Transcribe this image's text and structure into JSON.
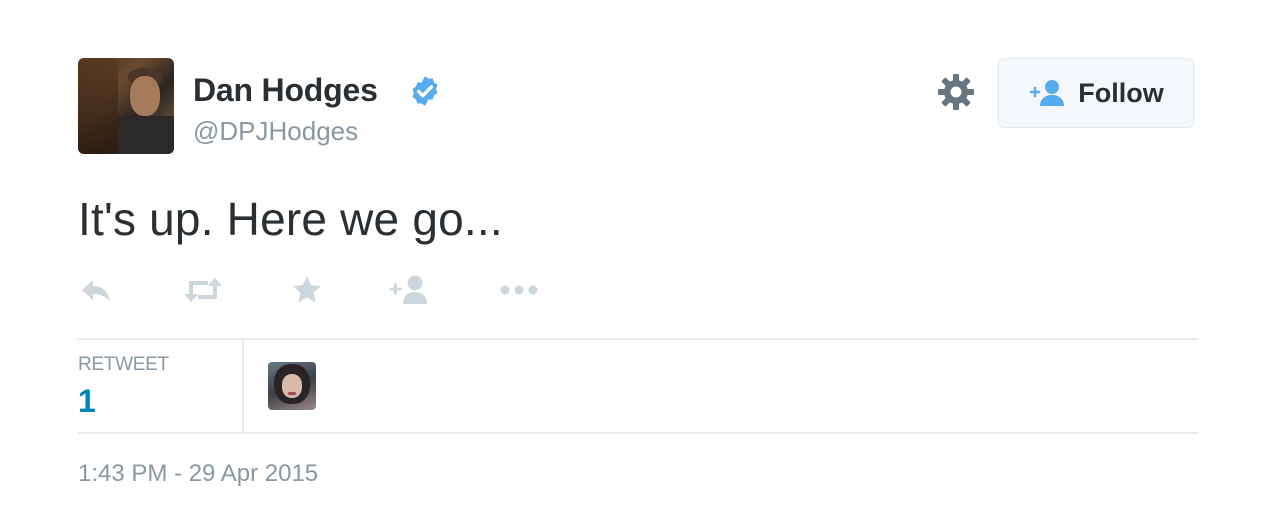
{
  "author": {
    "name": "Dan Hodges",
    "handle": "@DPJHodges",
    "verified": true
  },
  "header_actions": {
    "settings_icon": "gear-icon",
    "follow_label": "Follow"
  },
  "tweet": {
    "text": "It's up. Here we go...",
    "timestamp": "1:43 PM - 29 Apr 2015"
  },
  "action_icons": [
    "reply-icon",
    "retweet-icon",
    "favorite-icon",
    "follow-icon",
    "more-icon"
  ],
  "stats": {
    "retweet_label": "RETWEET",
    "retweet_count": "1"
  },
  "colors": {
    "text": "#292f33",
    "muted": "#8899a6",
    "link": "#0084b4",
    "verified": "#55acee",
    "action": "#ccd6dd"
  }
}
